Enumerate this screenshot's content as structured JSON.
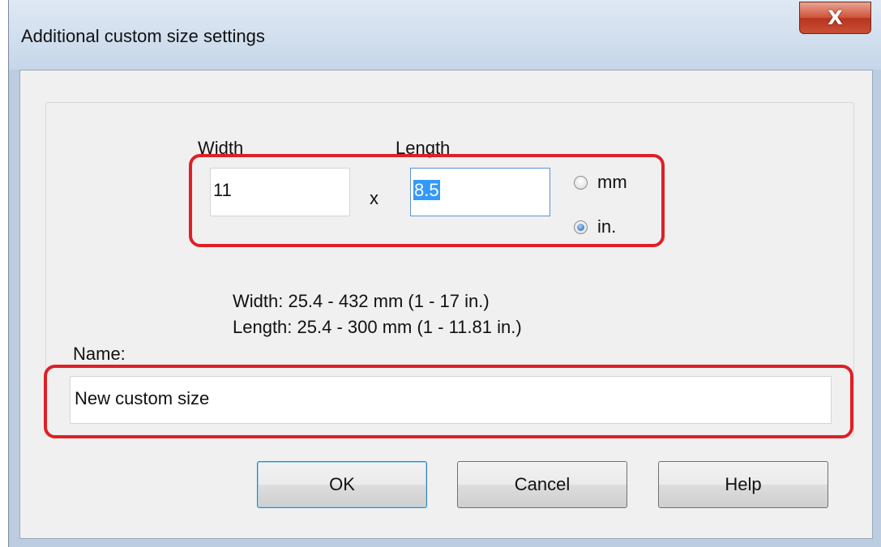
{
  "window": {
    "title": "Additional custom size settings",
    "close_glyph": "X"
  },
  "size": {
    "width_label": "Width",
    "length_label": "Length",
    "width_value": "11",
    "length_value": "8.5",
    "separator": "x",
    "unit_mm": "mm",
    "unit_in": "in.",
    "selected_unit": "in."
  },
  "ranges": {
    "width_range": "Width: 25.4 - 432 mm   (1 - 17 in.)",
    "length_range": "Length: 25.4 - 300 mm   (1 - 11.81 in.)"
  },
  "name": {
    "label": "Name:",
    "value": "New custom size"
  },
  "buttons": {
    "ok": "OK",
    "cancel": "Cancel",
    "help": "Help"
  },
  "colors": {
    "highlight": "#e01f26",
    "selection": "#3399ff",
    "close": "#c94f35"
  }
}
